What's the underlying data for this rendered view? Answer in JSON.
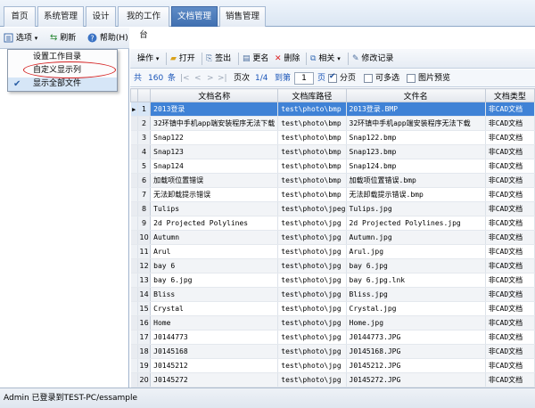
{
  "tabs": [
    {
      "label": "首页",
      "active": false
    },
    {
      "label": "系统管理",
      "active": false
    },
    {
      "label": "设计",
      "active": false
    },
    {
      "label": "我的工作台",
      "active": false
    },
    {
      "label": "文档管理",
      "active": true
    },
    {
      "label": "销售管理",
      "active": false
    }
  ],
  "left_toolbar": {
    "options_label": "选项",
    "refresh_label": "刷新",
    "help_label": "帮助(H)"
  },
  "options_menu": {
    "items": [
      {
        "label": "设置工作目录",
        "checked": false
      },
      {
        "label": "自定义显示列",
        "checked": false
      },
      {
        "label": "显示全部文件",
        "checked": true
      }
    ]
  },
  "right_toolbar": {
    "operate": "操作",
    "open": "打开",
    "checkout": "签出",
    "rename": "更名",
    "delete": "删除",
    "related": "相关",
    "history": "修改记录"
  },
  "pager": {
    "total_prefix": "共",
    "total": "160",
    "total_suffix": "条",
    "page_text": "1/4",
    "page_label": "页次",
    "goto_label": "到第",
    "page_input": "1",
    "page_suffix": "页",
    "paging_label": "分页",
    "paging_checked": true,
    "multiselect_label": "可多选",
    "multiselect_checked": false,
    "preview_label": "图片预览",
    "preview_checked": false
  },
  "grid": {
    "columns": [
      "文档名称",
      "文档库路径",
      "文件名",
      "文档类型"
    ],
    "rows": [
      {
        "n": "1",
        "name": "2013登录",
        "path": "test\\photo\\bmp",
        "file": "2013登录.BMP",
        "type": "非CAD文档"
      },
      {
        "n": "2",
        "name": "32环镇中手机app端安装程序无法下载",
        "path": "test\\photo\\bmp",
        "file": "32环镇中手机app端安装程序无法下载",
        "type": "非CAD文档"
      },
      {
        "n": "3",
        "name": "Snap122",
        "path": "test\\photo\\bmp",
        "file": "Snap122.bmp",
        "type": "非CAD文档"
      },
      {
        "n": "4",
        "name": "Snap123",
        "path": "test\\photo\\bmp",
        "file": "Snap123.bmp",
        "type": "非CAD文档"
      },
      {
        "n": "5",
        "name": "Snap124",
        "path": "test\\photo\\bmp",
        "file": "Snap124.bmp",
        "type": "非CAD文档"
      },
      {
        "n": "6",
        "name": "加载项位置错误",
        "path": "test\\photo\\bmp",
        "file": "加载项位置错误.bmp",
        "type": "非CAD文档"
      },
      {
        "n": "7",
        "name": "无法卸载提示错误",
        "path": "test\\photo\\bmp",
        "file": "无法卸载提示错误.bmp",
        "type": "非CAD文档"
      },
      {
        "n": "8",
        "name": "Tulips",
        "path": "test\\photo\\jpeg",
        "file": "Tulips.jpg",
        "type": "非CAD文档"
      },
      {
        "n": "9",
        "name": "2d Projected Polylines",
        "path": "test\\photo\\jpg",
        "file": "2d Projected Polylines.jpg",
        "type": "非CAD文档"
      },
      {
        "n": "10",
        "name": "Autumn",
        "path": "test\\photo\\jpg",
        "file": "Autumn.jpg",
        "type": "非CAD文档"
      },
      {
        "n": "11",
        "name": "Arul",
        "path": "test\\photo\\jpg",
        "file": "Arul.jpg",
        "type": "非CAD文档"
      },
      {
        "n": "12",
        "name": "bay 6",
        "path": "test\\photo\\jpg",
        "file": "bay 6.jpg",
        "type": "非CAD文档"
      },
      {
        "n": "13",
        "name": "bay 6.jpg",
        "path": "test\\photo\\jpg",
        "file": "bay 6.jpg.lnk",
        "type": "非CAD文档"
      },
      {
        "n": "14",
        "name": "Bliss",
        "path": "test\\photo\\jpg",
        "file": "Bliss.jpg",
        "type": "非CAD文档"
      },
      {
        "n": "15",
        "name": "Crystal",
        "path": "test\\photo\\jpg",
        "file": "Crystal.jpg",
        "type": "非CAD文档"
      },
      {
        "n": "16",
        "name": "Home",
        "path": "test\\photo\\jpg",
        "file": "Home.jpg",
        "type": "非CAD文档"
      },
      {
        "n": "17",
        "name": "J0144773",
        "path": "test\\photo\\jpg",
        "file": "J0144773.JPG",
        "type": "非CAD文档"
      },
      {
        "n": "18",
        "name": "J0145168",
        "path": "test\\photo\\jpg",
        "file": "J0145168.JPG",
        "type": "非CAD文档"
      },
      {
        "n": "19",
        "name": "J0145212",
        "path": "test\\photo\\jpg",
        "file": "J0145212.JPG",
        "type": "非CAD文档"
      },
      {
        "n": "20",
        "name": "J0145272",
        "path": "test\\photo\\jpg",
        "file": "J0145272.JPG",
        "type": "非CAD文档"
      }
    ]
  },
  "status_bar": {
    "text": "Admin 已登录到TEST-PC/essample"
  },
  "colors": {
    "selection": "#3f82d6",
    "active_tab": "#4a7bbd",
    "highlight_circle": "#d42020"
  }
}
